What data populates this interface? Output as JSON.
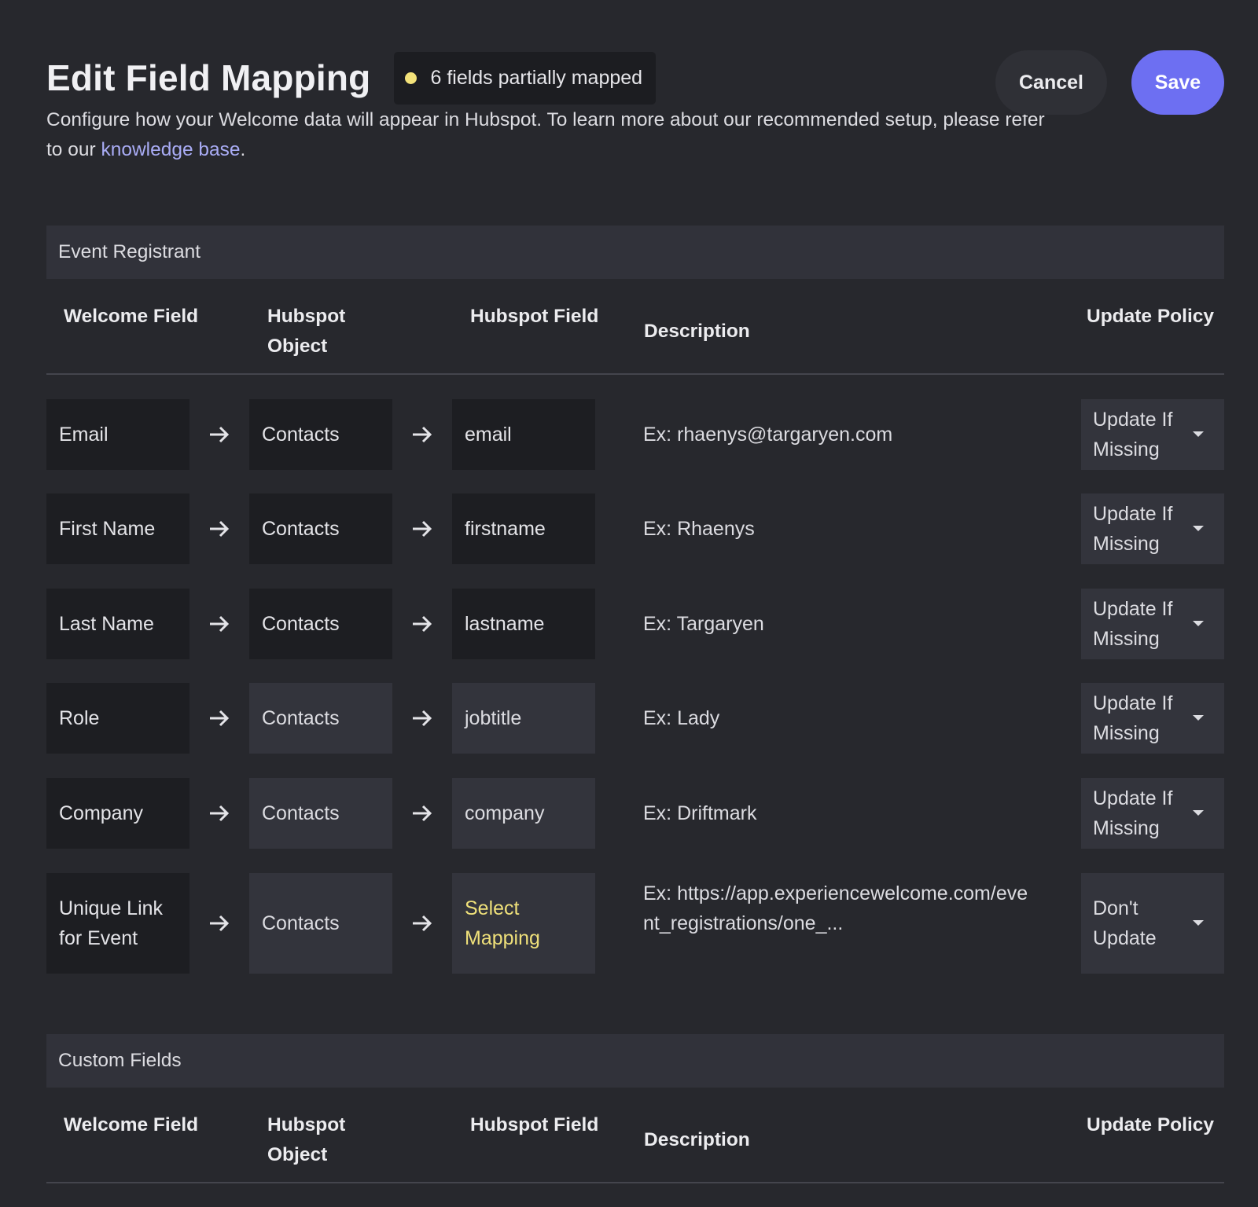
{
  "page": {
    "title": "Edit Field Mapping",
    "status_badge": "6 fields partially mapped",
    "subtitle_before_link": "Configure how your Welcome data will appear in Hubspot. To learn more about our recommended setup, please refer to our ",
    "link_text": "knowledge base",
    "subtitle_after_link": ".",
    "cancel_label": "Cancel",
    "save_label": "Save"
  },
  "columns": {
    "welcome_field": "Welcome Field",
    "hubspot_object": "Hubspot Object",
    "hubspot_field": "Hubspot Field",
    "description": "Description",
    "update_policy": "Update Policy"
  },
  "sections": [
    {
      "title": "Event Registrant",
      "rows": [
        {
          "welcome_field": "Email",
          "hubspot_object": "Contacts",
          "hubspot_field": "email",
          "description": "Ex: rhaenys@targaryen.com",
          "policy": "Update If Missing"
        },
        {
          "welcome_field": "First Name",
          "hubspot_object": "Contacts",
          "hubspot_field": "firstname",
          "description": "Ex: Rhaenys",
          "policy": "Update If Missing"
        },
        {
          "welcome_field": "Last Name",
          "hubspot_object": "Contacts",
          "hubspot_field": "lastname",
          "description": "Ex: Targaryen",
          "policy": "Update If Missing"
        },
        {
          "welcome_field": "Role",
          "hubspot_object": "Contacts",
          "hubspot_field": "jobtitle",
          "description": "Ex: Lady",
          "policy": "Update If Missing"
        },
        {
          "welcome_field": "Company",
          "hubspot_object": "Contacts",
          "hubspot_field": "company",
          "description": "Ex: Driftmark",
          "policy": "Update If Missing"
        },
        {
          "welcome_field": "Unique Link for Event",
          "hubspot_object": "Contacts",
          "hubspot_field": "Select Mapping",
          "description": "Ex: https://app.experiencewelcome.com/event_registrations/one_...",
          "policy": "Don't Update"
        }
      ]
    },
    {
      "title": "Custom Fields",
      "rows": []
    }
  ],
  "colors": {
    "background": "#27282d",
    "accent": "#6d6ff2",
    "warning": "#efe07a",
    "link": "#a9acf5"
  },
  "icons": {
    "status_dot": "status-dot-icon",
    "arrow": "arrow-right-icon",
    "dropdown": "caret-down-icon"
  }
}
